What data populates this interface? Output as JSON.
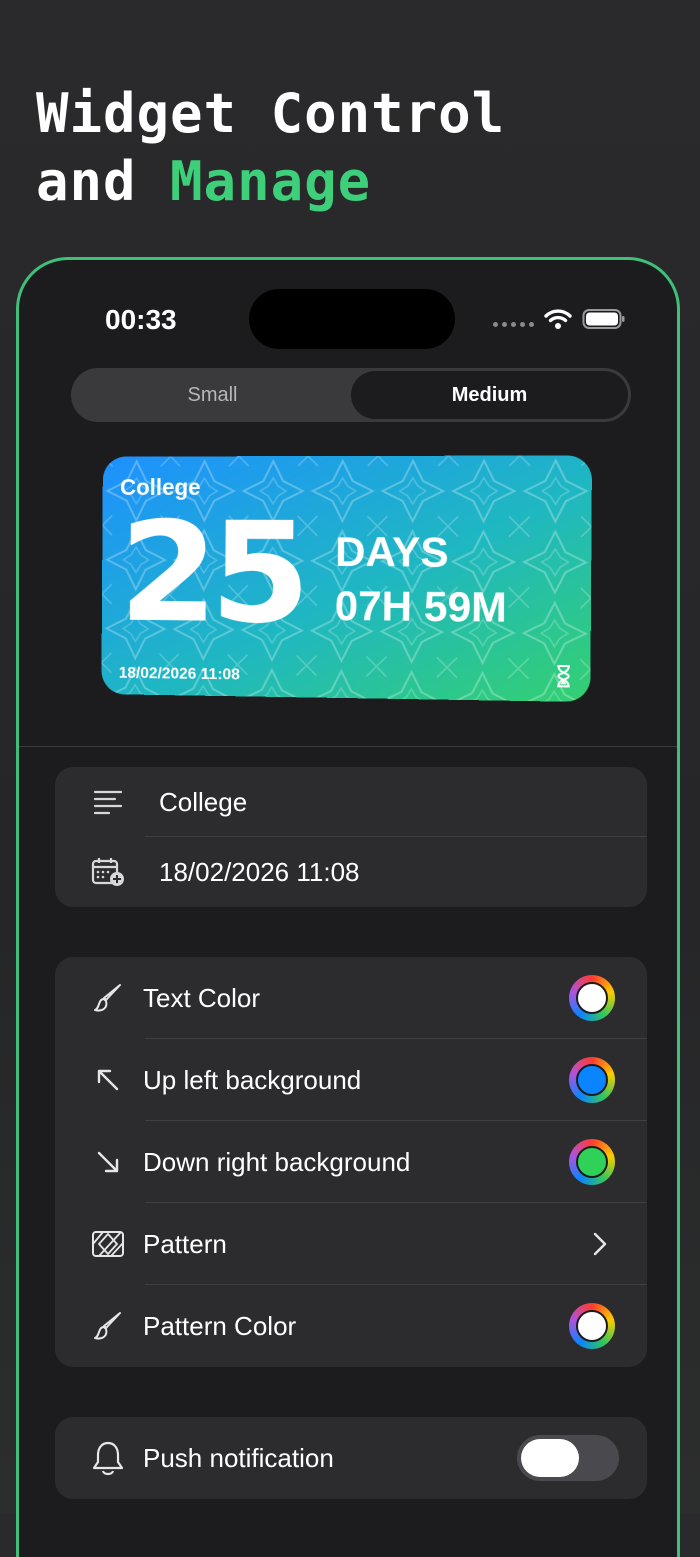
{
  "headline": {
    "line1": "Widget Control",
    "line2_plain": "and ",
    "line2_accent": "Manage",
    "accent_color": "#3ecf7a"
  },
  "status_bar": {
    "time": "00:33",
    "icons": [
      "signal-dots-icon",
      "wifi-icon",
      "battery-icon"
    ]
  },
  "size_selector": {
    "options": [
      "Small",
      "Medium"
    ],
    "selected": "Medium"
  },
  "widget": {
    "title": "College",
    "big_number": "25",
    "days_label": "DAYS",
    "time_left": "07H 59M",
    "date": "18/02/2026 11:08",
    "gradient_start": "#1e90ff",
    "gradient_end": "#34c759",
    "icon": "hourglass-icon"
  },
  "details": [
    {
      "icon": "text-lines-icon",
      "value": "College"
    },
    {
      "icon": "calendar-add-icon",
      "value": "18/02/2026 11:08"
    }
  ],
  "appearance": [
    {
      "icon": "paintbrush-icon",
      "label": "Text Color",
      "color": "#ffffff"
    },
    {
      "icon": "arrow-up-left-icon",
      "label": "Up left background",
      "color": "#0a84ff"
    },
    {
      "icon": "arrow-down-right-icon",
      "label": "Down right background",
      "color": "#30d158"
    },
    {
      "icon": "pattern-icon",
      "label": "Pattern"
    },
    {
      "icon": "paintbrush-icon",
      "label": "Pattern Color",
      "color": "#ffffff"
    }
  ],
  "notifications": {
    "icon": "bell-icon",
    "label": "Push notification",
    "enabled": false
  }
}
